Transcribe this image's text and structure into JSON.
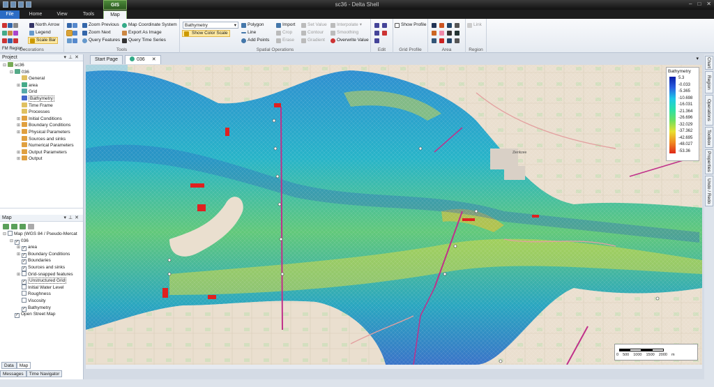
{
  "window": {
    "title": "sc36 - Delta Shell"
  },
  "ribbon_tabs": {
    "contextual_group": "GIS",
    "file": "File",
    "home": "Home",
    "view": "View",
    "tools": "Tools",
    "map": "Map"
  },
  "ribbon": {
    "decorations": {
      "label": "Decorations",
      "north_arrow": "North Arrow",
      "legend": "Legend",
      "scale_bar": "Scale Bar",
      "fm_region": "FM Region..."
    },
    "tools": {
      "label": "Tools",
      "zoom_previous": "Zoom Previous",
      "zoom_next": "Zoom Next",
      "query_features": "Query Features",
      "map_coordinate_system": "Map Coordinate System",
      "export_as_image": "Export As Image",
      "query_time_series": "Query Time Series"
    },
    "layer_select": "Bathymetry",
    "show_color_scale": "Show Color Scale",
    "spatial": {
      "label": "Spatial Operations",
      "polygon": "Polygon",
      "line": "Line",
      "add_points": "Add Points",
      "import": "Import",
      "crop": "Crop",
      "erase": "Erase",
      "set_value": "Set Value",
      "contour": "Contour",
      "gradient": "Gradient",
      "interpolate": "Interpolate",
      "smoothing": "Smoothing",
      "overwrite_value": "Overwrite Value"
    },
    "edit": {
      "label": "Edit"
    },
    "grid_profile": {
      "label": "Grid Profile",
      "show_profile": "Show Profile"
    },
    "area": {
      "label": "Area"
    },
    "region": {
      "label": "Region",
      "link": "Link"
    }
  },
  "project_panel": {
    "title": "Project",
    "items": [
      {
        "label": "sc36",
        "level": 0,
        "expander": "⊟",
        "color": "#7a5"
      },
      {
        "label": "036",
        "level": 1,
        "expander": "⊟",
        "color": "#5a8"
      },
      {
        "label": "General",
        "level": 2,
        "expander": "",
        "color": "#e0c060"
      },
      {
        "label": "area",
        "level": 2,
        "expander": "⊞",
        "color": "#4a8"
      },
      {
        "label": "Grid",
        "level": 2,
        "expander": "",
        "color": "#5aa"
      },
      {
        "label": "Bathymetry",
        "level": 2,
        "expander": "",
        "color": "#46c"
      },
      {
        "label": "Time Frame",
        "level": 2,
        "expander": "",
        "color": "#e0c060"
      },
      {
        "label": "Processes",
        "level": 2,
        "expander": "",
        "color": "#e0c060"
      },
      {
        "label": "Initial Conditions",
        "level": 2,
        "expander": "⊞",
        "color": "#e0a040"
      },
      {
        "label": "Boundary Conditions",
        "level": 2,
        "expander": "⊞",
        "color": "#e0a040"
      },
      {
        "label": "Physical Parameters",
        "level": 2,
        "expander": "⊞",
        "color": "#e0a040"
      },
      {
        "label": "Sources and sinks",
        "level": 2,
        "expander": "",
        "color": "#e0a040"
      },
      {
        "label": "Numerical Parameters",
        "level": 2,
        "expander": "",
        "color": "#e0a040"
      },
      {
        "label": "Output Parameters",
        "level": 2,
        "expander": "⊞",
        "color": "#e0a040"
      },
      {
        "label": "Output",
        "level": 2,
        "expander": "⊞",
        "color": "#e0a040"
      }
    ]
  },
  "map_panel": {
    "title": "Map",
    "items": [
      {
        "label": "Map (WGS 84 / Pseudo-Mercat",
        "level": 0,
        "expander": "⊟",
        "check": ""
      },
      {
        "label": "036",
        "level": 1,
        "expander": "⊟",
        "check": "✓"
      },
      {
        "label": "area",
        "level": 2,
        "expander": "⊞",
        "check": "✓"
      },
      {
        "label": "Boundary Conditions",
        "level": 2,
        "expander": "⊞",
        "check": "✓"
      },
      {
        "label": "Boundaries",
        "level": 2,
        "expander": "",
        "check": "✓"
      },
      {
        "label": "Sources and sinks",
        "level": 2,
        "expander": "",
        "check": "✓"
      },
      {
        "label": "Grid-snapped features",
        "level": 2,
        "expander": "⊞",
        "check": ""
      },
      {
        "label": "Unstructured Grid",
        "level": 2,
        "expander": "",
        "check": "✓"
      },
      {
        "label": "Initial Water Level",
        "level": 2,
        "expander": "",
        "check": ""
      },
      {
        "label": "Roughness",
        "level": 2,
        "expander": "",
        "check": ""
      },
      {
        "label": "Viscosity",
        "level": 2,
        "expander": "",
        "check": ""
      },
      {
        "label": "Bathymetry",
        "level": 2,
        "expander": "",
        "check": "✓"
      },
      {
        "label": "Open Street Map",
        "level": 1,
        "expander": "",
        "check": "✓"
      }
    ]
  },
  "left_tabs": {
    "data": "Data",
    "map": "Map"
  },
  "bottom_tabs": {
    "messages": "Messages",
    "time_navigator": "Time Navigator"
  },
  "doc_tabs": {
    "start_page": "Start Page",
    "model": "036"
  },
  "right_tabs": [
    "Chart",
    "Region",
    "Operations",
    "Toolbox",
    "Properties",
    "Undo / Redo"
  ],
  "legend": {
    "title": "Bathymetry",
    "values": [
      "5.3",
      "-0.033",
      "-5.365",
      "-10.698",
      "-16.031",
      "-21.364",
      "-26.696",
      "-32.029",
      "-37.362",
      "-42.695",
      "-48.027",
      "-53.36"
    ]
  },
  "scale_bar": {
    "ticks": [
      "0",
      "500",
      "1000",
      "1500",
      "2000"
    ],
    "unit": "m"
  },
  "map_labels": {
    "town": "Zierikzee"
  }
}
